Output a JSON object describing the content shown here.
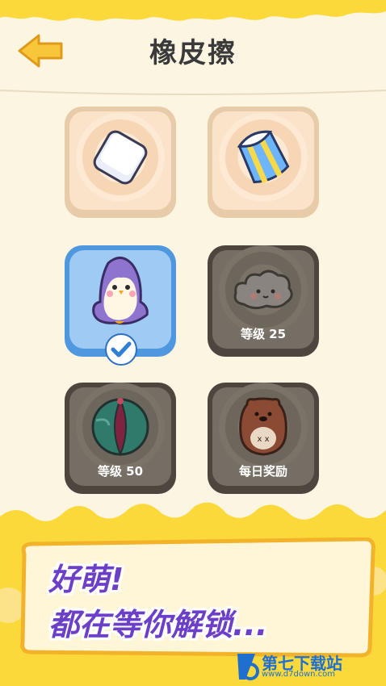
{
  "header": {
    "title": "橡皮擦"
  },
  "colors": {
    "accent_yellow": "#fbd93a",
    "locked_card": "#756e64",
    "selected_card": "#9fcaf3",
    "unlocked_card": "#fbe3c9",
    "banner_text": "#6b3fc7"
  },
  "items": [
    {
      "name": "白色橡皮",
      "icon": "white-eraser-icon",
      "state": "unlocked",
      "label": ""
    },
    {
      "name": "蓝色铅笔橡皮",
      "icon": "blue-striped-eraser-icon",
      "state": "unlocked",
      "label": ""
    },
    {
      "name": "企鹅橡皮",
      "icon": "penguin-eraser-icon",
      "state": "selected",
      "label": ""
    },
    {
      "name": "云朵橡皮",
      "icon": "cloud-eraser-icon",
      "state": "locked",
      "label": "等级 25"
    },
    {
      "name": "沙滩球橡皮",
      "icon": "beach-ball-eraser-icon",
      "state": "locked",
      "label": "等级 50"
    },
    {
      "name": "小熊橡皮",
      "icon": "bear-eraser-icon",
      "state": "locked",
      "label": "每日奖励"
    }
  ],
  "banner": {
    "line1": "好萌!",
    "line2": "都在等你解锁..."
  },
  "watermark": {
    "name": "第七下载站",
    "url": "www.d7down.com"
  }
}
